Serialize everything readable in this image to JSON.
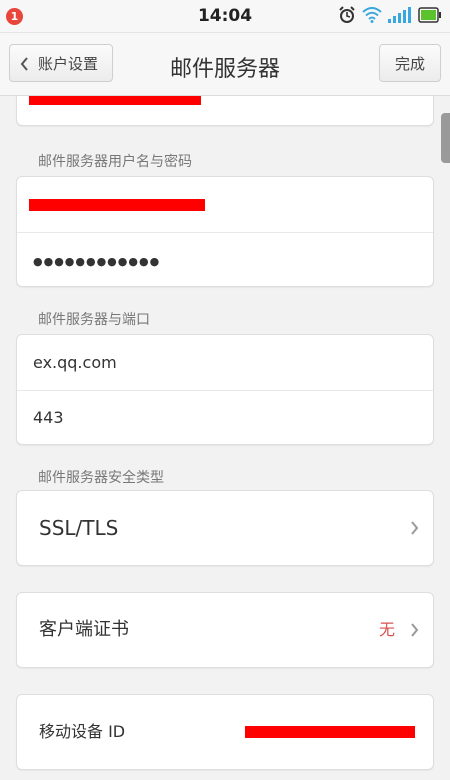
{
  "status_bar": {
    "notification_count": "1",
    "time": "14:04",
    "icons": [
      "alarm-icon",
      "wifi-icon",
      "signal-icon",
      "battery-icon"
    ]
  },
  "nav": {
    "back_label": "账户设置",
    "title": "邮件服务器",
    "done_label": "完成"
  },
  "sections": {
    "credentials_label": "邮件服务器用户名与密码",
    "password_value": "●●●●●●●●●●●●",
    "server_port_label": "邮件服务器与端口",
    "server_value": "ex.qq.com",
    "port_value": "443",
    "security_label": "邮件服务器安全类型",
    "security_value": "SSL/TLS",
    "client_cert_label": "客户端证书",
    "client_cert_value": "无",
    "device_id_label": "移动设备 ID"
  },
  "colors": {
    "accent_none": "#d9534f",
    "redaction": "#ff0000",
    "battery": "#5cc22e",
    "wifi": "#3aa8e0"
  }
}
